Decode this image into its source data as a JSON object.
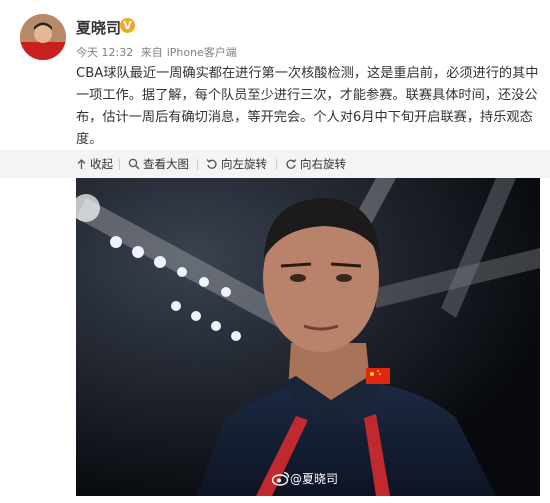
{
  "post": {
    "author": "夏晓司",
    "verified_badge": "V",
    "time": "今天 12:32",
    "source_prefix": "来自",
    "source": "iPhone客户端",
    "content": "CBA球队最近一周确实都在进行第一次核酸检测，这是重启前，必须进行的其中一项工作。据了解，每个队员至少进行三次，才能参赛。联赛具体时间，还没公布，估计一周后有确切消息，等开完会。个人对6月中下旬开启联赛，持乐观态度。"
  },
  "toolbar": {
    "collapse": "收起",
    "view_large": "查看大图",
    "rotate_left": "向左旋转",
    "rotate_right": "向右旋转"
  },
  "image": {
    "watermark": "@夏晓司"
  },
  "colors": {
    "text": "#333333",
    "meta": "#808080",
    "toolbar_bg": "#f4f4f4",
    "badge": "#f5a623"
  }
}
